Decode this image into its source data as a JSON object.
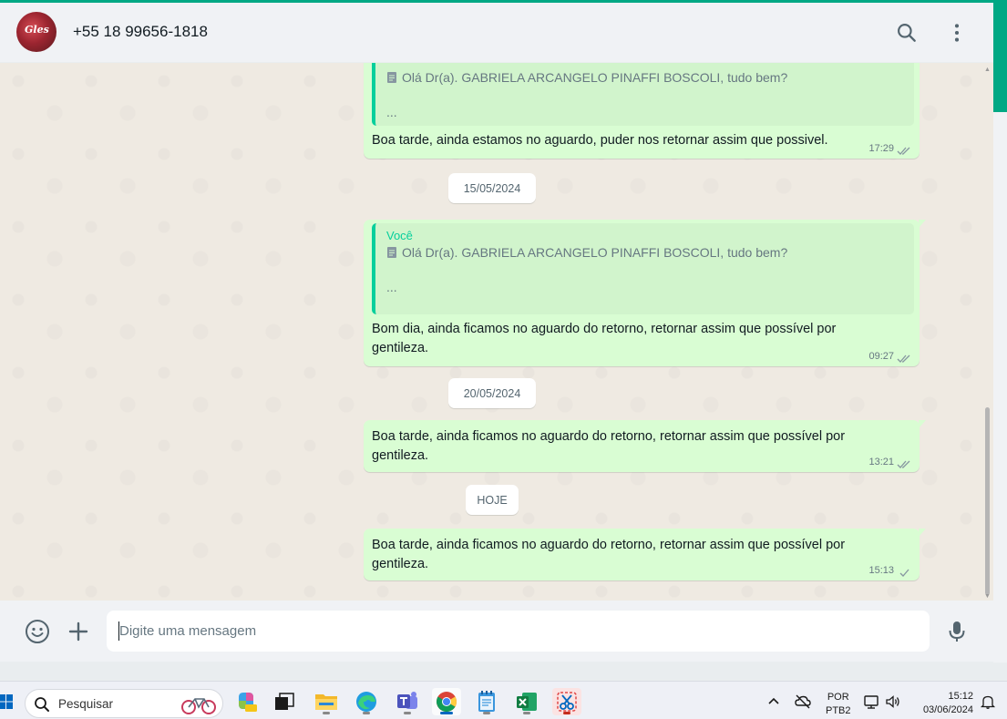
{
  "colors": {
    "accent": "#00a884",
    "chat_background": "#efeae2",
    "outgoing_bubble": "#d9fdd3",
    "header_background": "#f0f2f5",
    "read_ticks": "#8696a0"
  },
  "header": {
    "avatar_text": "Gles",
    "contact_name": "+55 18 99656-1818",
    "icons": [
      "search-icon",
      "menu-dots-icon"
    ]
  },
  "messages": [
    {
      "kind": "bubble",
      "quote": {
        "author": "",
        "line": "Olá Dr(a). GABRIELA ARCANGELO PINAFFI BOSCOLI, tudo bem?",
        "ellipsis": "..."
      },
      "text": "Boa tarde, ainda estamos no aguardo, puder nos retornar assim que possivel.",
      "time": "17:29",
      "status": "read"
    },
    {
      "kind": "date",
      "label": "15/05/2024"
    },
    {
      "kind": "bubble",
      "quote": {
        "author": "Você",
        "line": "Olá Dr(a). GABRIELA ARCANGELO PINAFFI BOSCOLI, tudo bem?",
        "ellipsis": "..."
      },
      "text": "Bom dia, ainda ficamos no aguardo do retorno, retornar assim que possível por gentileza.",
      "time": "09:27",
      "status": "read"
    },
    {
      "kind": "date",
      "label": "20/05/2024"
    },
    {
      "kind": "bubble",
      "text": "Boa tarde, ainda ficamos no aguardo do retorno, retornar assim que possível por gentileza.",
      "time": "13:21",
      "status": "read"
    },
    {
      "kind": "date",
      "label": "HOJE"
    },
    {
      "kind": "bubble",
      "text": "Boa tarde, ainda ficamos no aguardo do retorno, retornar assim que possível por gentileza.",
      "time": "15:13",
      "status": "sent"
    }
  ],
  "composer": {
    "placeholder": "Digite uma mensagem",
    "value": "",
    "icons": [
      "emoji-icon",
      "plus-icon",
      "microphone-icon"
    ]
  },
  "taskbar": {
    "search_label": "Pesquisar",
    "apps": [
      "copilot-icon",
      "task-view-icon",
      "file-explorer-icon",
      "edge-icon",
      "teams-icon",
      "chrome-icon",
      "notepad-icon",
      "excel-icon",
      "snipping-tool-icon"
    ],
    "active_app": "chrome-icon",
    "language_line1": "POR",
    "language_line2": "PTB2",
    "time": "15:12",
    "date": "03/06/2024"
  }
}
